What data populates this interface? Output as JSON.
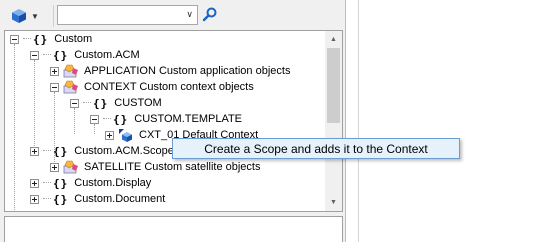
{
  "toolbar": {
    "dropdown_icon": "cube-icon",
    "combo": {
      "value": "",
      "placeholder": ""
    },
    "search_icon": "search-icon"
  },
  "tree": {
    "nodes": [
      {
        "id": "custom",
        "label": "Custom",
        "type": "namespace",
        "expanded": true
      },
      {
        "id": "custom-acm",
        "label": "Custom.ACM",
        "type": "namespace",
        "expanded": true
      },
      {
        "id": "application",
        "label": "APPLICATION Custom application objects",
        "type": "object-class",
        "expanded": false
      },
      {
        "id": "context",
        "label": "CONTEXT Custom context objects",
        "type": "object-class",
        "expanded": true
      },
      {
        "id": "custom-inner",
        "label": "CUSTOM",
        "type": "namespace",
        "expanded": true
      },
      {
        "id": "custom-template",
        "label": "CUSTOM.TEMPLATE",
        "type": "namespace",
        "expanded": true
      },
      {
        "id": "cxt01",
        "label": "CXT_01 Default Context",
        "type": "object",
        "expanded": false
      },
      {
        "id": "custom-acm-scope",
        "label": "Custom.ACM.Scope",
        "type": "namespace",
        "expanded": false
      },
      {
        "id": "satellite",
        "label": "SATELLITE Custom satellite objects",
        "type": "object-class",
        "expanded": false
      },
      {
        "id": "custom-display",
        "label": "Custom.Display",
        "type": "namespace",
        "expanded": false
      },
      {
        "id": "custom-document",
        "label": "Custom.Document",
        "type": "namespace",
        "expanded": false
      }
    ]
  },
  "tooltip": {
    "text": "Create a Scope and adds it to the Context"
  },
  "colors": {
    "tooltip_bg": "#e5f1fb",
    "tooltip_border": "#6d9cd0",
    "panel_bg": "#f0f0f0"
  }
}
